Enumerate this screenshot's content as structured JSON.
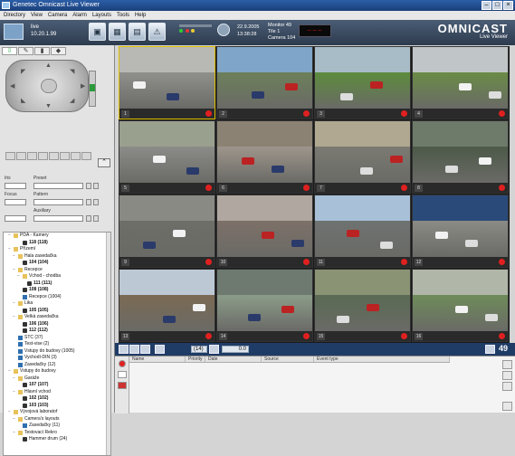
{
  "window": {
    "title": "Genetec Omnicast Live Viewer"
  },
  "menu": [
    "Directory",
    "View",
    "Camera",
    "Alarm",
    "Layouts",
    "Tools",
    "Help"
  ],
  "toolbar": {
    "user": "live",
    "ip": "10.20.1.99",
    "status_count": "0",
    "date": "22.9.2005",
    "time": "13:38:28",
    "monitor_label": "Monitor",
    "monitor_value": "49",
    "tile_label": "Tile",
    "tile_value": "1",
    "camera_label": "Camera",
    "camera_value": "104",
    "led": "~~~"
  },
  "logo": {
    "word": "OMNICAST",
    "sub": "Live Viewer"
  },
  "ptz": {
    "form": {
      "iris": "Iris",
      "preset": "Preset",
      "focus": "Focus",
      "pattern": "Pattern",
      "auxiliary": "Auxiliary"
    }
  },
  "tree": [
    {
      "indent": 1,
      "pm": "−",
      "icon": "fold",
      "text": "PDA - Kamery",
      "bold": false
    },
    {
      "indent": 3,
      "pm": "",
      "icon": "cam",
      "text": "118 (118)",
      "bold": true
    },
    {
      "indent": 1,
      "pm": "−",
      "icon": "fold",
      "text": "Přízemí",
      "bold": false
    },
    {
      "indent": 2,
      "pm": "−",
      "icon": "fold",
      "text": "Hala zasedačka",
      "bold": false
    },
    {
      "indent": 3,
      "pm": "",
      "icon": "cam",
      "text": "104 (104)",
      "bold": true
    },
    {
      "indent": 2,
      "pm": "−",
      "icon": "fold",
      "text": "Recepce",
      "bold": false
    },
    {
      "indent": 3,
      "pm": "−",
      "icon": "fold",
      "text": "Vchod - chodba",
      "bold": false
    },
    {
      "indent": 4,
      "pm": "",
      "icon": "cam",
      "text": "111 (111)",
      "bold": true
    },
    {
      "indent": 3,
      "pm": "",
      "icon": "cam",
      "text": "108 (108)",
      "bold": true
    },
    {
      "indent": 3,
      "pm": "",
      "icon": "blue",
      "text": "Recepce (1004)",
      "bold": false
    },
    {
      "indent": 2,
      "pm": "−",
      "icon": "fold",
      "text": "Lika",
      "bold": false
    },
    {
      "indent": 3,
      "pm": "",
      "icon": "cam",
      "text": "105 (105)",
      "bold": true
    },
    {
      "indent": 2,
      "pm": "−",
      "icon": "fold",
      "text": "Velká zasedačka",
      "bold": false
    },
    {
      "indent": 3,
      "pm": "",
      "icon": "cam",
      "text": "106 (106)",
      "bold": true
    },
    {
      "indent": 3,
      "pm": "",
      "icon": "cam",
      "text": "112 (112)",
      "bold": true
    },
    {
      "indent": 2,
      "pm": "",
      "icon": "blue",
      "text": "STC (37)",
      "bold": false
    },
    {
      "indent": 2,
      "pm": "",
      "icon": "blue",
      "text": "Test-vise (2)",
      "bold": false
    },
    {
      "indent": 2,
      "pm": "",
      "icon": "blue",
      "text": "Vstupy do budovy (1005)",
      "bold": false
    },
    {
      "indent": 2,
      "pm": "",
      "icon": "blue",
      "text": "Vychodí-DIN (3)",
      "bold": false
    },
    {
      "indent": 2,
      "pm": "",
      "icon": "blue",
      "text": "Zasedačky (12)",
      "bold": false
    },
    {
      "indent": 1,
      "pm": "−",
      "icon": "fold",
      "text": "Vstupy do budovy",
      "bold": false
    },
    {
      "indent": 2,
      "pm": "−",
      "icon": "fold",
      "text": "Garáže",
      "bold": false
    },
    {
      "indent": 3,
      "pm": "",
      "icon": "cam",
      "text": "107 (107)",
      "bold": true
    },
    {
      "indent": 2,
      "pm": "−",
      "icon": "fold",
      "text": "Hlavní vchod",
      "bold": false
    },
    {
      "indent": 3,
      "pm": "",
      "icon": "cam",
      "text": "102 (102)",
      "bold": true
    },
    {
      "indent": 3,
      "pm": "",
      "icon": "cam",
      "text": "103 (103)",
      "bold": true
    },
    {
      "indent": 1,
      "pm": "−",
      "icon": "fold",
      "text": "Vývojová laboratoř",
      "bold": false
    },
    {
      "indent": 2,
      "pm": "−",
      "icon": "fold",
      "text": "Camera's layouts",
      "bold": false
    },
    {
      "indent": 3,
      "pm": "",
      "icon": "blue",
      "text": "Zasedačky (11)",
      "bold": false
    },
    {
      "indent": 2,
      "pm": "−",
      "icon": "fold",
      "text": "Testovací Rekro",
      "bold": false
    },
    {
      "indent": 3,
      "pm": "",
      "icon": "cam",
      "text": "Hammer drum (24)",
      "bold": false
    }
  ],
  "tiles": [
    {
      "num": "1",
      "sky": "#b8b8b4",
      "road": "#8e8e8a",
      "sel": true
    },
    {
      "num": "2",
      "sky": "#7fa5c8",
      "road": "#6c7f5a"
    },
    {
      "num": "3",
      "sky": "#a8bcc8",
      "road": "#5d8a3e"
    },
    {
      "num": "4",
      "sky": "#c0c6c8",
      "road": "#6a8a48"
    },
    {
      "num": "5",
      "sky": "#9aa08e",
      "road": "#8a8a86"
    },
    {
      "num": "6",
      "sky": "#8c8274",
      "road": "#9c948a"
    },
    {
      "num": "7",
      "sky": "#b0a890",
      "road": "#7a7a72"
    },
    {
      "num": "8",
      "sky": "#6e7a6a",
      "road": "#4e5a4a"
    },
    {
      "num": "9",
      "sky": "#8a8a84",
      "road": "#6e6e68"
    },
    {
      "num": "10",
      "sky": "#b0a8a0",
      "road": "#7c7068"
    },
    {
      "num": "11",
      "sky": "#a8c0d8",
      "road": "#6e7270"
    },
    {
      "num": "12",
      "sky": "#2a4a7a",
      "road": "#8a8a84"
    },
    {
      "num": "13",
      "sky": "#bcc8d4",
      "road": "#7a6a54"
    },
    {
      "num": "14",
      "sky": "#6e7a70",
      "road": "#8a9a88"
    },
    {
      "num": "15",
      "sky": "#8a9474",
      "road": "#5a6a54"
    },
    {
      "num": "16",
      "sky": "#b0b6a8",
      "road": "#6e8a5a"
    }
  ],
  "events": {
    "count_badge": "49",
    "count_box": "(14)",
    "value_box": "0.0",
    "columns": [
      "Name",
      "Priority",
      "Date",
      "Source",
      "Event type"
    ]
  },
  "colors": {
    "titlebar": "#1b3f7a",
    "accent": "#e0c000",
    "rec": "#e02020"
  }
}
